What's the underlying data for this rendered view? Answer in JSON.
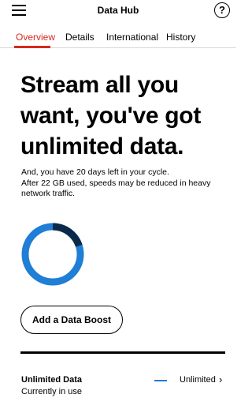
{
  "header": {
    "title": "Data Hub",
    "menu_icon": "hamburger-menu-icon",
    "help_icon": "question-mark-icon",
    "help_glyph": "?"
  },
  "tabs": [
    {
      "label": "Overview",
      "active": true
    },
    {
      "label": "Details",
      "active": false
    },
    {
      "label": "International",
      "active": false
    },
    {
      "label": "History",
      "active": false
    }
  ],
  "main": {
    "headline": "Stream all you want, you've got unlimited data.",
    "subtext_line1": "And, you have 20 days left in your cycle.",
    "subtext_line2": "After 22 GB used, speeds may be reduced in heavy network traffic.",
    "boost_button": "Add a Data Boost"
  },
  "usage_gauge": {
    "level": 0.2,
    "track_color": "#1f7ed6",
    "fill_color": "#0b2a4a"
  },
  "plan": {
    "name": "Unlimited Data",
    "value": "Unlimited",
    "status": "Currently in use",
    "chevron_icon": "chevron-right-icon",
    "chevron_glyph": "›",
    "legend_color": "#1f7ed6"
  },
  "colors": {
    "accent": "#d52b1e",
    "text": "#000000"
  }
}
